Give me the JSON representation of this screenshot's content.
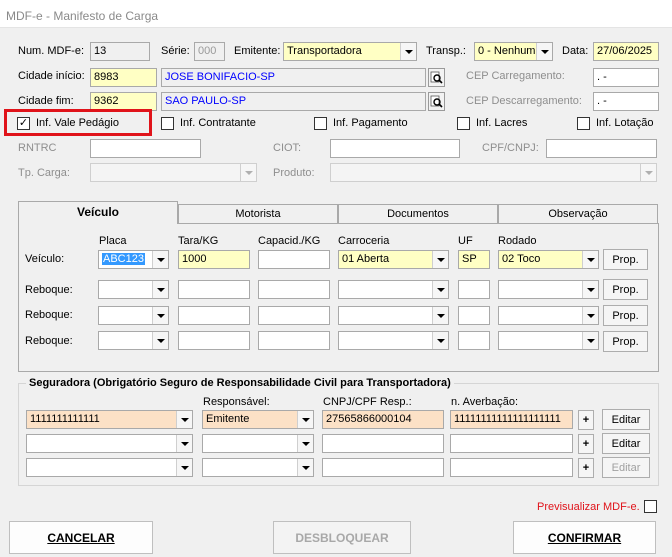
{
  "window": {
    "title": "MDF-e - Manifesto de Carga"
  },
  "header": {
    "num_label": "Num. MDF-e:",
    "num_value": "13",
    "serie_label": "Série:",
    "serie_value": "000",
    "emitente_label": "Emitente:",
    "emitente_value": "Transportadora",
    "transp_label": "Transp.:",
    "transp_value": "0 - Nenhum",
    "data_label": "Data:",
    "data_value": "27/06/2025"
  },
  "cidades": {
    "inicio_label": "Cidade início:",
    "inicio_code": "8983",
    "inicio_name": "JOSE BONIFACIO-SP",
    "fim_label": "Cidade fim:",
    "fim_code": "9362",
    "fim_name": "SAO PAULO-SP",
    "cep_carreg_label": "CEP Carregamento:",
    "cep_carreg_value": " .  -",
    "cep_descarreg_label": "CEP Descarregamento:",
    "cep_descarreg_value": " .  -"
  },
  "checks": {
    "vale_pedagio": "Inf. Vale Pedágio",
    "contratante": "Inf. Contratante",
    "pagamento": "Inf. Pagamento",
    "lacres": "Inf. Lacres",
    "lotacao": "Inf. Lotação",
    "vale_pedagio_mark": "✓"
  },
  "extra": {
    "rntrc_label": "RNTRC",
    "ciot_label": "CIOT:",
    "cpf_label": "CPF/CNPJ:",
    "tp_carga_label": "Tp. Carga:",
    "produto_label": "Produto:"
  },
  "tabs": {
    "veiculo": "Veículo",
    "motorista": "Motorista",
    "documentos": "Documentos",
    "observacao": "Observação"
  },
  "vehicle": {
    "col_placa": "Placa",
    "col_tara": "Tara/KG",
    "col_capacid": "Capacid./KG",
    "col_carroceria": "Carroceria",
    "col_uf": "UF",
    "col_rodado": "Rodado",
    "veiculo_label": "Veículo:",
    "reboque_label": "Reboque:",
    "placa": "ABC123",
    "tara": "1000",
    "carroceria": "01 Aberta",
    "uf": "SP",
    "rodado": "02 Toco",
    "prop_label": "Prop."
  },
  "seguradora": {
    "title": "Seguradora (Obrigatório Seguro de Responsabilidade Civil para Transportadora)",
    "resp_label": "Responsável:",
    "cnpj_label": "CNPJ/CPF Resp.:",
    "averb_label": "n. Averbação:",
    "row1_seg": "1111111111111",
    "row1_resp": "Emitente",
    "row1_cnpj": "27565866000104",
    "row1_averb": "11111111111111111111",
    "plus_label": "+",
    "editar_label": "Editar"
  },
  "footer": {
    "preview_label": "Previsualizar MDF-e.",
    "cancel": "CANCELAR",
    "unlock": "DESBLOQUEAR",
    "confirm": "CONFIRMAR"
  },
  "colors": {
    "highlight_box": "#e0131a",
    "preview_text": "#e0131a",
    "selection": "#3399ff"
  }
}
